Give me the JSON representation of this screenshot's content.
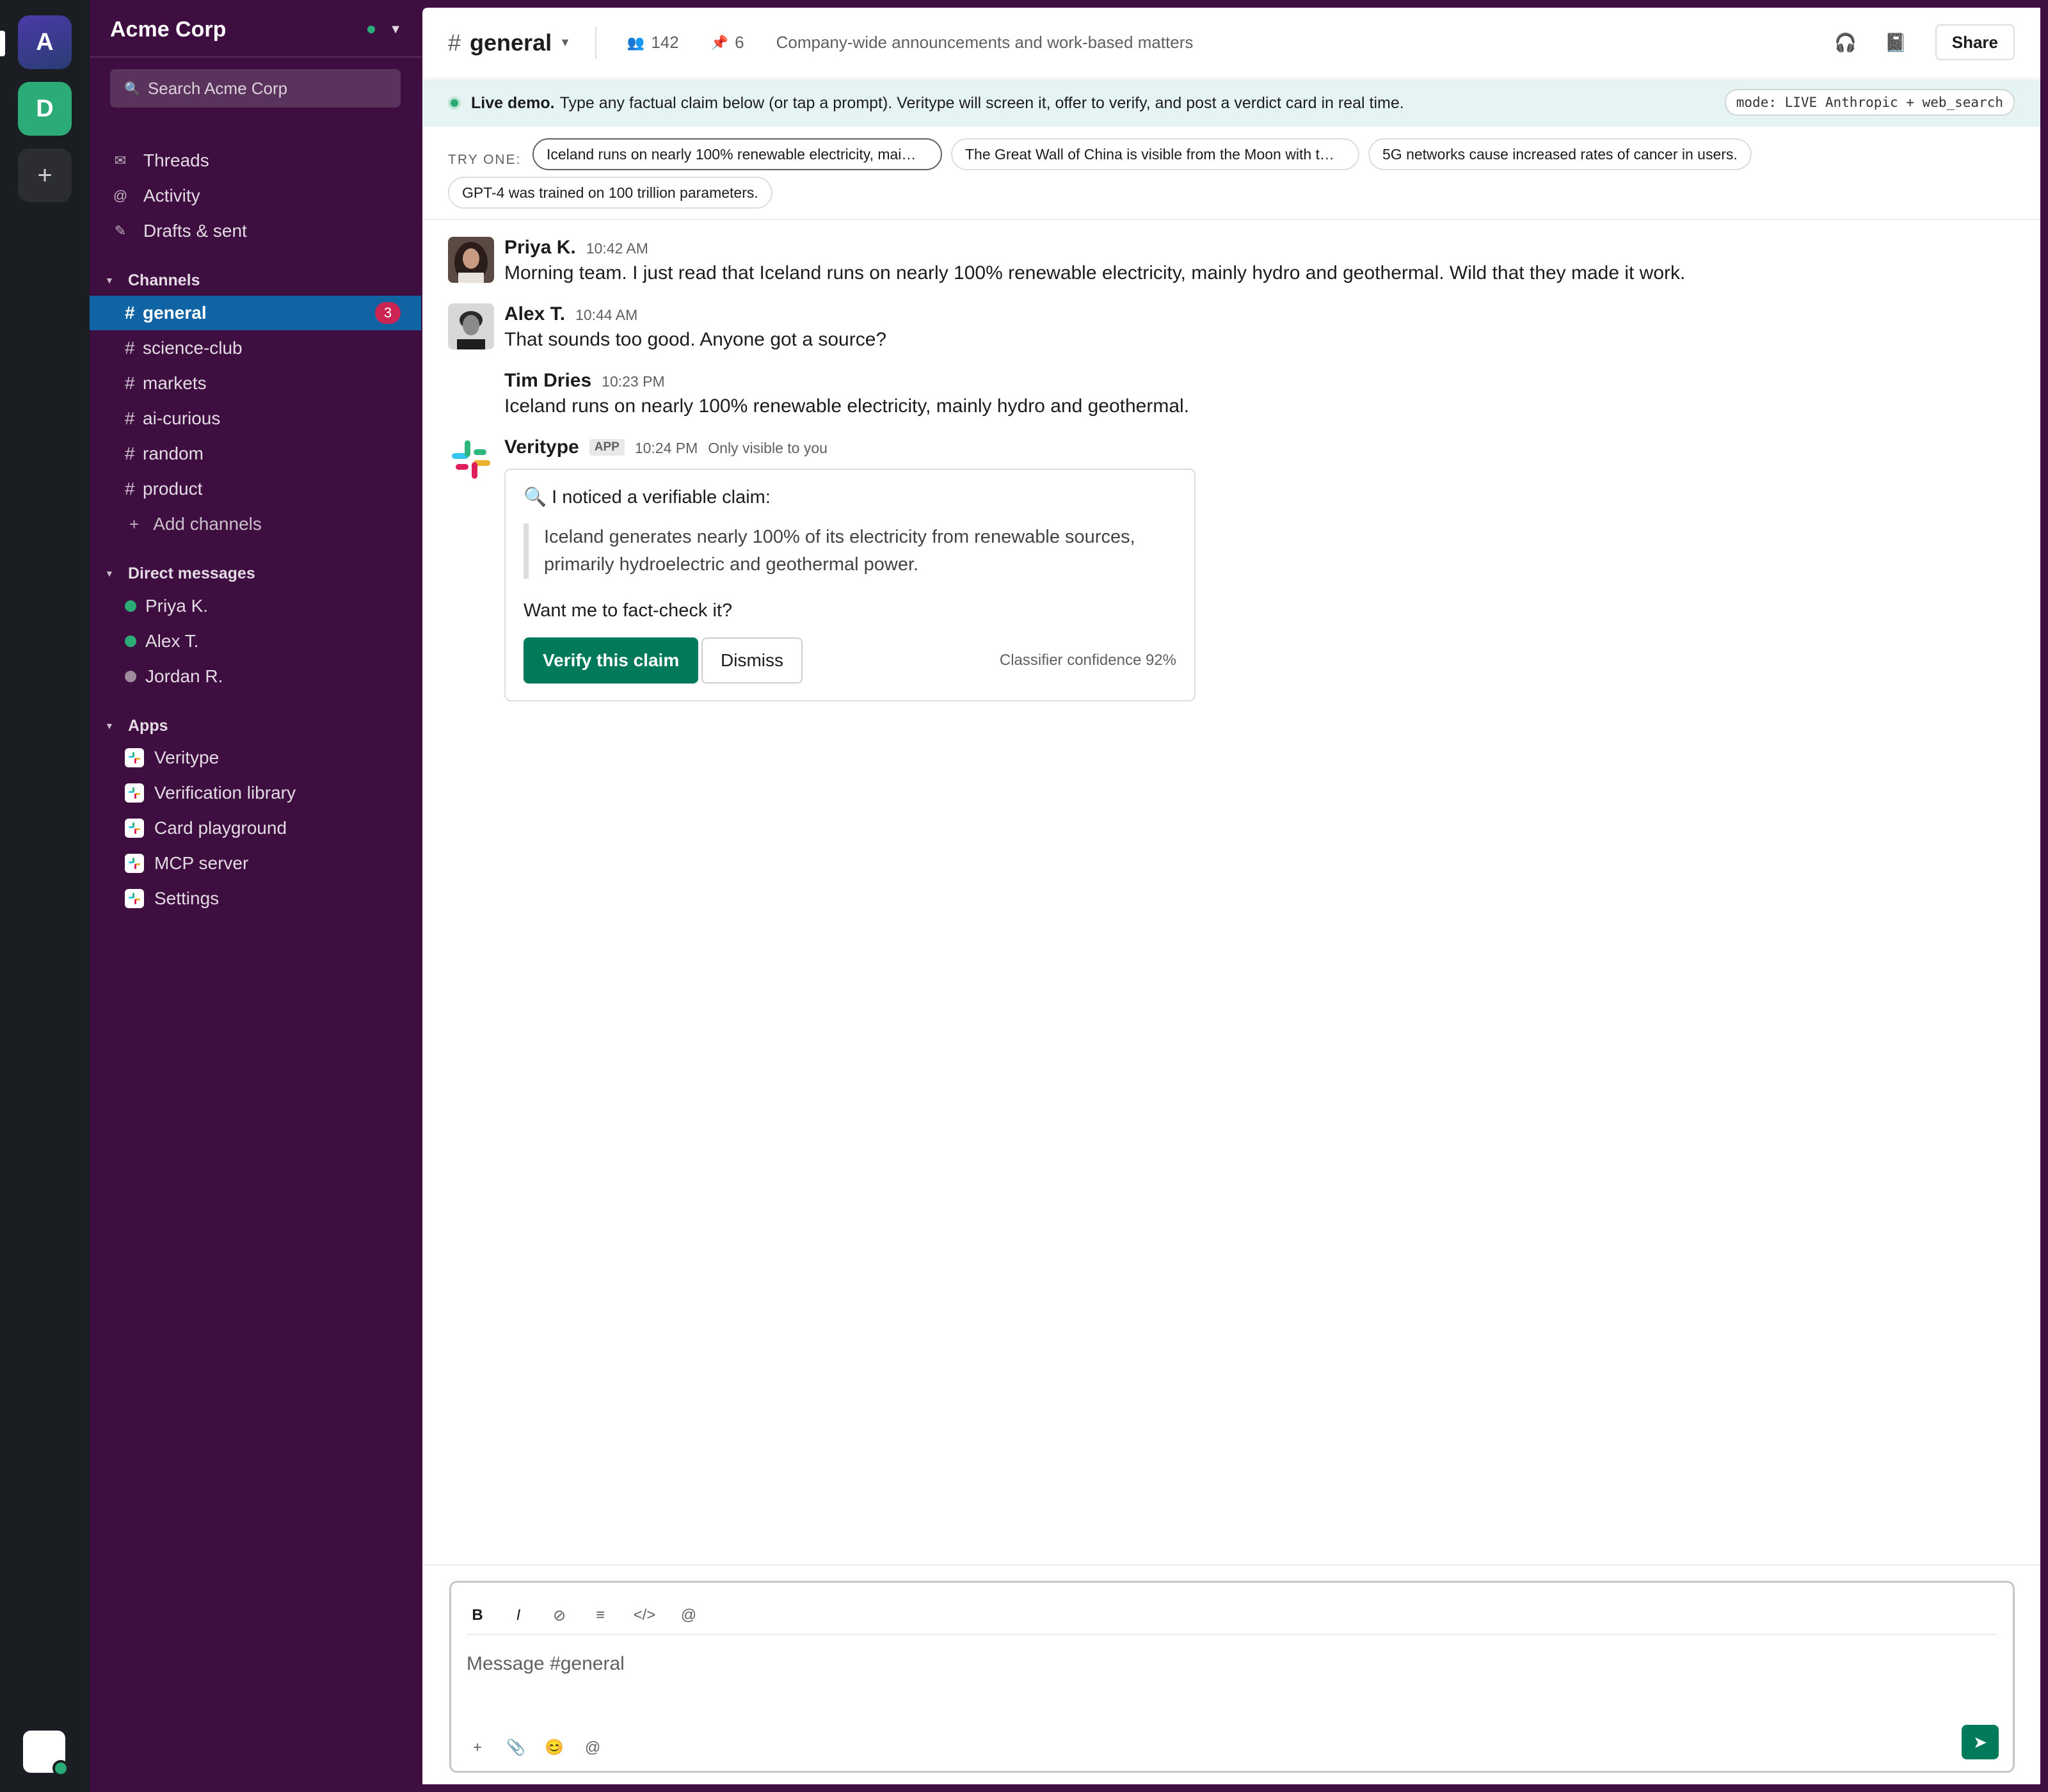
{
  "rail": {
    "ws1": "A",
    "ws2": "D",
    "add": "+"
  },
  "workspace": {
    "name": "Acme Corp",
    "search_placeholder": "Search Acme Corp"
  },
  "nav": [
    {
      "label": "Threads",
      "icon": "threads-icon"
    },
    {
      "label": "Activity",
      "icon": "mention-icon"
    },
    {
      "label": "Drafts & sent",
      "icon": "pencil-icon"
    }
  ],
  "channels": {
    "heading": "Channels",
    "items": [
      {
        "name": "general",
        "active": true,
        "badge": "3"
      },
      {
        "name": "science-club"
      },
      {
        "name": "markets"
      },
      {
        "name": "ai-curious"
      },
      {
        "name": "random"
      },
      {
        "name": "product"
      }
    ],
    "add_label": "Add channels"
  },
  "dms": {
    "heading": "Direct messages",
    "items": [
      {
        "name": "Priya K.",
        "status": "#2bac76"
      },
      {
        "name": "Alex T.",
        "status": "#2bac76"
      },
      {
        "name": "Jordan R.",
        "status": "#9e8a9e"
      }
    ]
  },
  "apps": {
    "heading": "Apps",
    "items": [
      "Veritype",
      "Verification library",
      "Card playground",
      "MCP server",
      "Settings"
    ]
  },
  "header": {
    "channel": "general",
    "members": "142",
    "pins": "6",
    "topic": "Company-wide announcements and work-based matters",
    "share": "Share"
  },
  "banner": {
    "bold": "Live demo.",
    "text": "Type any factual claim below (or tap a prompt). Veritype will screen it, offer to verify, and post a verdict card in real time.",
    "mode": "mode: LIVE Anthropic + web_search"
  },
  "try_one": {
    "label": "TRY ONE:",
    "chips": [
      "Iceland runs on nearly 100% renewable electricity, mai…",
      "The Great Wall of China is visible from the Moon with t…",
      "5G networks cause increased rates of cancer in users.",
      "GPT-4 was trained on 100 trillion parameters."
    ]
  },
  "messages": [
    {
      "author": "Priya K.",
      "time": "10:42 AM",
      "text": "Morning team. I just read that Iceland runs on nearly 100% renewable electricity, mainly hydro and geothermal. Wild that they made it work."
    },
    {
      "author": "Alex T.",
      "time": "10:44 AM",
      "text": "That sounds too good. Anyone got a source?"
    },
    {
      "author": "Tim Dries",
      "time": "10:23 PM",
      "text": "Iceland runs on nearly 100% renewable electricity, mainly hydro and geothermal."
    },
    {
      "author": "Veritype",
      "tag": "APP",
      "time": "10:24 PM",
      "visibility": "Only visible to you"
    }
  ],
  "card": {
    "title": "I noticed a verifiable claim:",
    "quote": "Iceland generates nearly 100% of its electricity from renewable sources, primarily hydroelectric and geothermal power.",
    "ask": "Want me to fact-check it?",
    "verify": "Verify this claim",
    "dismiss": "Dismiss",
    "confidence": "Classifier confidence 92%"
  },
  "composer": {
    "placeholder": "Message #general",
    "format_icons": [
      "B",
      "I",
      "⊘",
      "≡",
      "</>",
      "@"
    ],
    "tool_icons": [
      "+",
      "📎",
      "😊",
      "@"
    ]
  },
  "colors": {
    "sidebar": "#3f0e40",
    "active": "#1164a3",
    "accent": "#007a5a",
    "badge": "#cd2553"
  }
}
